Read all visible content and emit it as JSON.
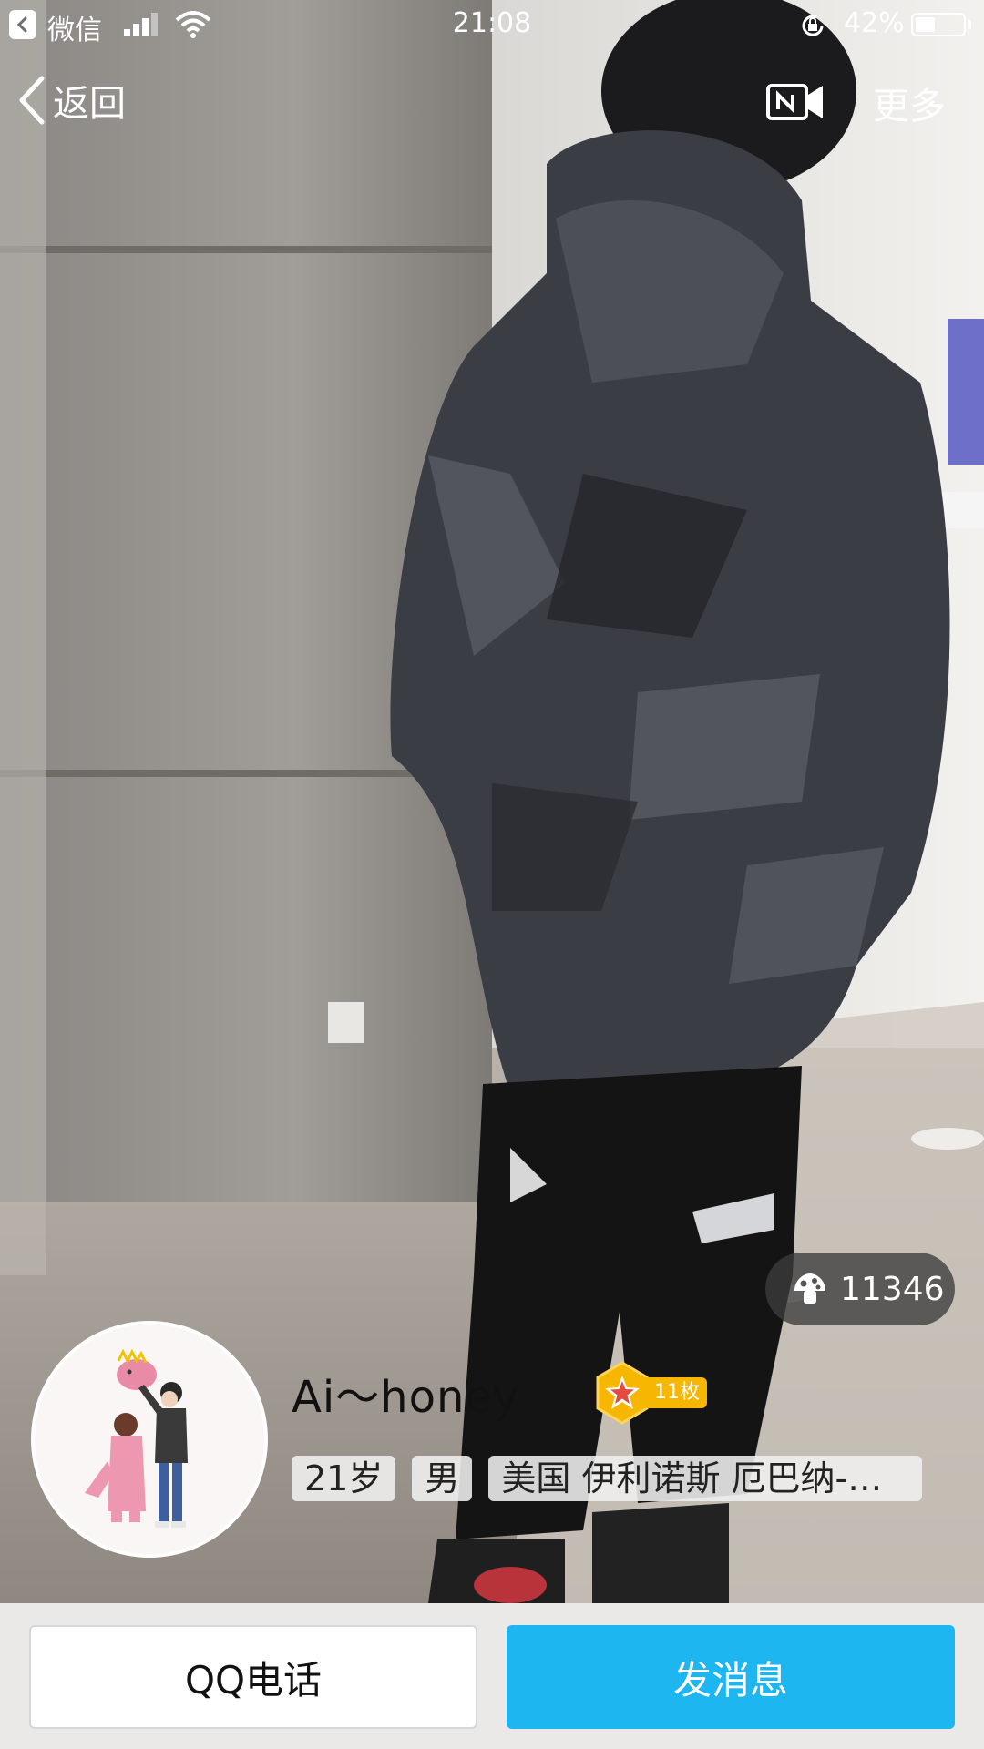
{
  "status_bar": {
    "app_name": "微信",
    "time": "21:08",
    "battery_percent": "42%",
    "battery_level": 0.42
  },
  "nav": {
    "back_label": "返回",
    "more_label": "更多"
  },
  "profile": {
    "likes": "11346",
    "nickname": "Ai～honey",
    "medal_count": "11枚",
    "age": "21岁",
    "gender": "男",
    "location": "美国 伊利诺斯 厄巴纳-…"
  },
  "actions": {
    "call_label": "QQ电话",
    "message_label": "发消息"
  },
  "colors": {
    "message_button": "#1eb6f0",
    "medal": "#f7b700"
  }
}
